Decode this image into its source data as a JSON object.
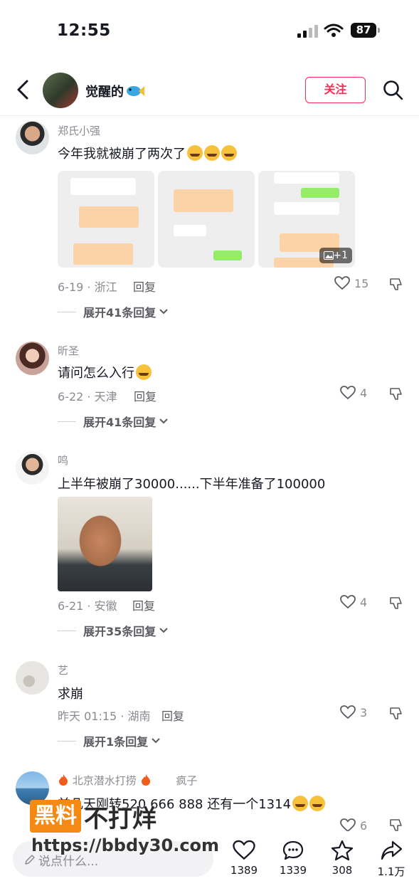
{
  "status": {
    "time": "12:55",
    "battery": "87"
  },
  "header": {
    "name": "觉醒的",
    "follow_label": "关注"
  },
  "comments": [
    {
      "user": "郑氏小强",
      "text": "今年我就被崩了两次了",
      "meta": "6-19 · 浙江",
      "reply": "回复",
      "likes": "15",
      "expand": "展开41条回复",
      "image_more": "+1"
    },
    {
      "user": "昕圣",
      "text": "请问怎么入行",
      "meta": "6-22 · 天津",
      "reply": "回复",
      "likes": "4",
      "expand": "展开41条回复"
    },
    {
      "user": "鸣",
      "text": "上半年被崩了30000......下半年准备了100000",
      "meta": "6-21 · 安徽",
      "reply": "回复",
      "likes": "4",
      "expand": "展开35条回复"
    },
    {
      "user": "艺",
      "text": "求崩",
      "meta": "昨天 01:15 · 湖南",
      "reply": "回复",
      "likes": "3",
      "expand": "展开1条回复"
    },
    {
      "user": "北京潜水打捞",
      "user_tag": "疯子",
      "text": "前几天刚转520 666 888 还有一个1314",
      "likes": "6"
    }
  ],
  "watermark": {
    "brand": "黑料",
    "tail": "不打烊",
    "url": "https://bbdy30.com"
  },
  "bottom": {
    "placeholder": "说点什么...",
    "like_count": "1389",
    "comment_count": "1339",
    "fav_count": "308",
    "share_count": "1.1万"
  }
}
